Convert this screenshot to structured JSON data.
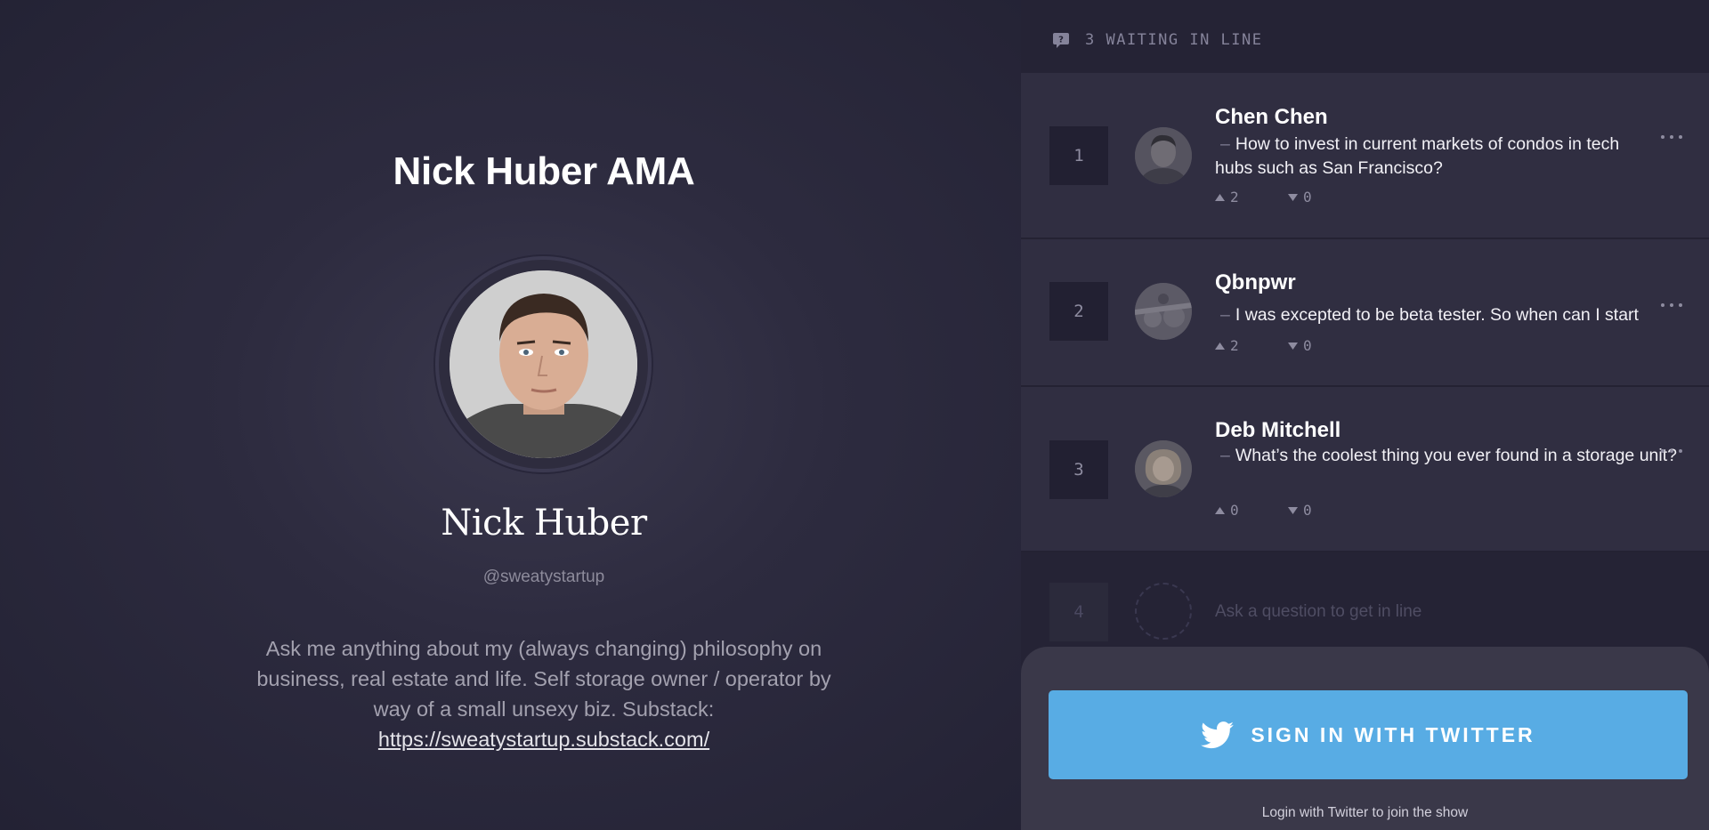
{
  "host": {
    "ama_title": "Nick Huber AMA",
    "name": "Nick Huber",
    "handle": "@sweatystartup",
    "bio_text": "Ask me anything about my (always changing) philosophy on business, real estate and life. Self storage owner / operator by way of a small unsexy biz. Substack: ",
    "bio_link": "https://sweatystartup.substack.com/"
  },
  "queue": {
    "count_label": "3 WAITING IN LINE",
    "items": [
      {
        "number": "1",
        "name": "Chen Chen",
        "dash": "–",
        "question": "How to invest in current markets of condos in tech hubs such as San Francisco?",
        "upvotes": "2",
        "downvotes": "0"
      },
      {
        "number": "2",
        "name": "Qbnpwr",
        "dash": "–",
        "question": "I was excepted to be beta tester. So when can I start",
        "upvotes": "2",
        "downvotes": "0"
      },
      {
        "number": "3",
        "name": "Deb Mitchell",
        "dash": "–",
        "question": "What’s the coolest thing you ever found in a storage unit?",
        "upvotes": "0",
        "downvotes": "0"
      }
    ],
    "next_number": "4",
    "next_placeholder": "Ask a question to get in line"
  },
  "signin": {
    "button_label": "SIGN IN WITH TWITTER",
    "note": "Login with Twitter to join the show"
  },
  "colors": {
    "twitter_blue": "#58ace4",
    "background": "#26243a",
    "card": "#302e41"
  }
}
